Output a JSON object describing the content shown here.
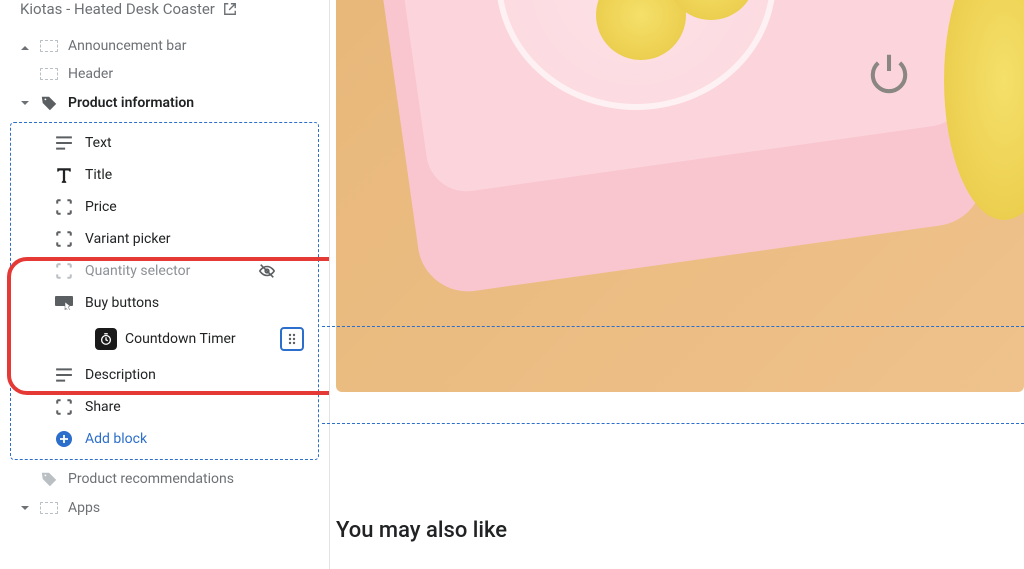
{
  "page": {
    "title": "Kiotas - Heated Desk Coaster"
  },
  "sidebar": {
    "announcement_bar": "Announcement bar",
    "header": "Header",
    "product_info_label": "Product information",
    "product_recommendations": "Product recommendations",
    "apps": "Apps"
  },
  "blocks": {
    "text": "Text",
    "title": "Title",
    "price": "Price",
    "variant_picker": "Variant picker",
    "quantity_selector": "Quantity selector",
    "buy_buttons": "Buy buttons",
    "countdown_timer": "Countdown Timer",
    "description": "Description",
    "share": "Share",
    "add_block": "Add block"
  },
  "main": {
    "section_heading": "You may also like"
  }
}
